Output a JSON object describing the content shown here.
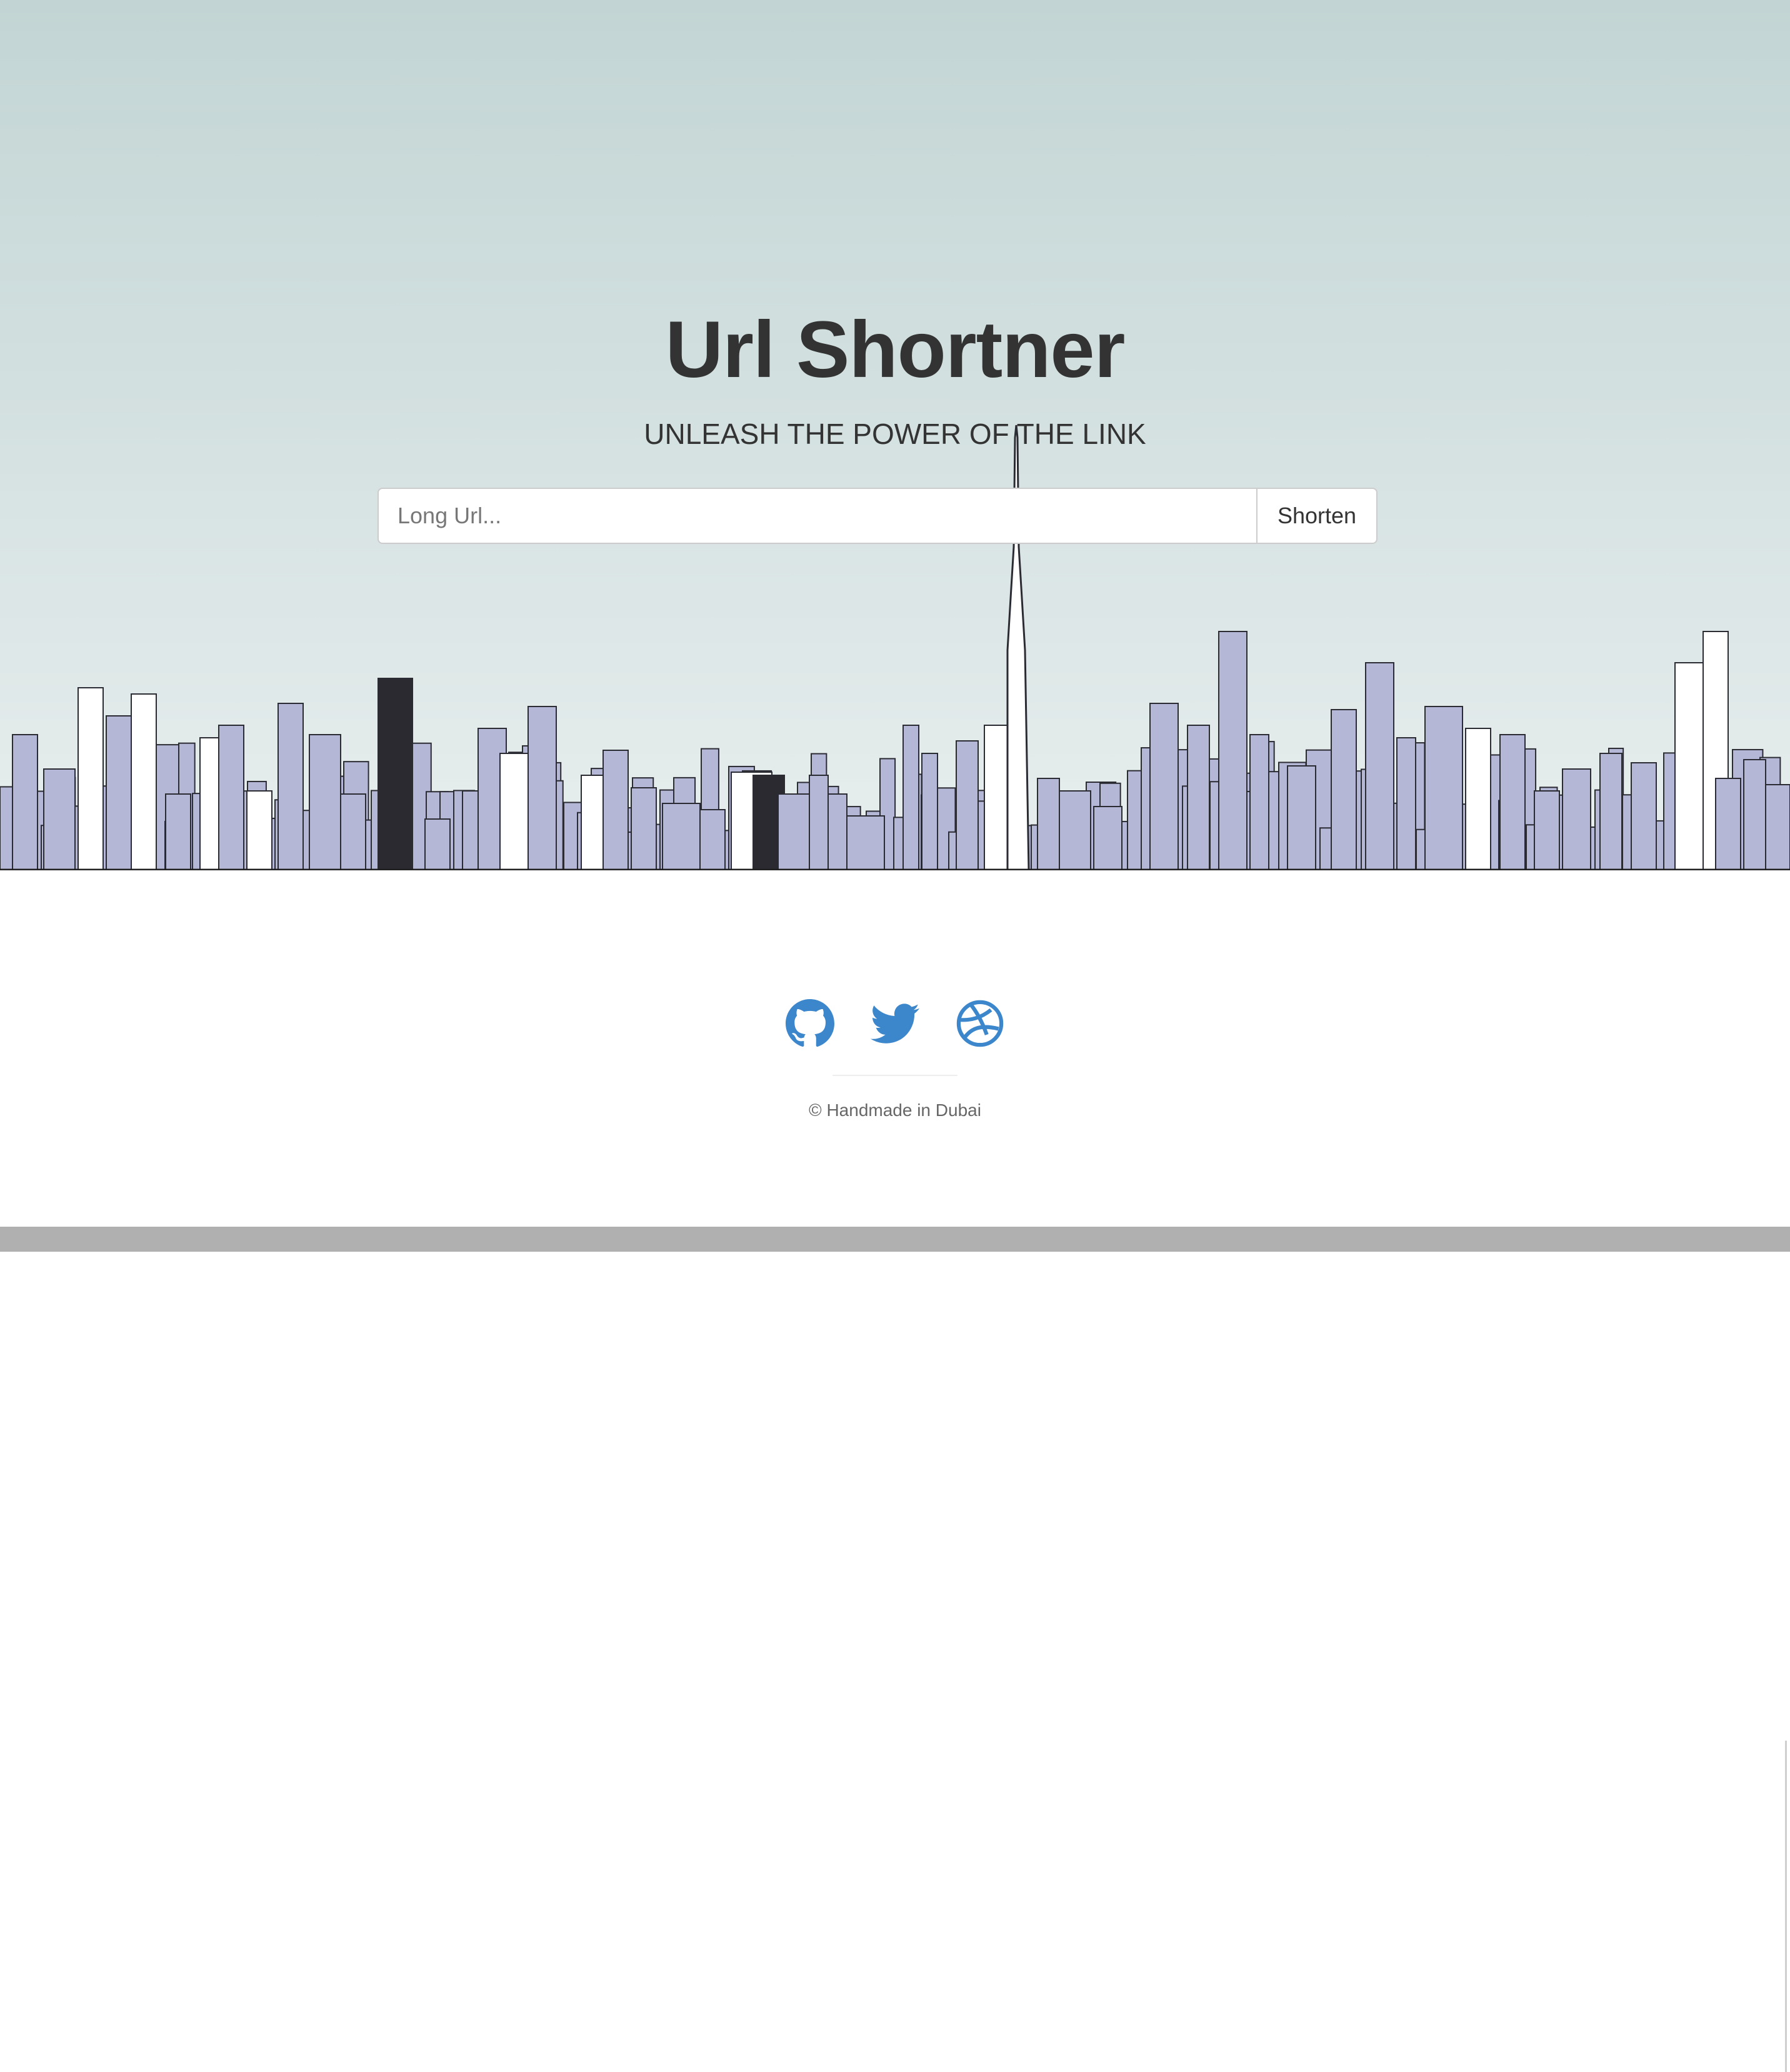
{
  "hero": {
    "title": "Url Shortner",
    "subtitle": "UNLEASH THE POWER OF THE LINK",
    "background_color_top": "#c2d5d4",
    "background_color_bottom": "#e8eeee"
  },
  "form": {
    "placeholder": "Long Url...",
    "value": "",
    "button_label": "Shorten"
  },
  "skyline": {
    "building_fill": "#b4b7d6",
    "building_stroke": "#2b2b33",
    "accent_fill": "#ffffff",
    "dark_fill": "#2a2a30"
  },
  "footer": {
    "social": [
      {
        "name": "github",
        "icon": "github-icon"
      },
      {
        "name": "twitter",
        "icon": "twitter-icon"
      },
      {
        "name": "dribbble",
        "icon": "dribbble-icon"
      }
    ],
    "icon_color": "#3c86cb",
    "copyright": "© Handmade in Dubai"
  }
}
